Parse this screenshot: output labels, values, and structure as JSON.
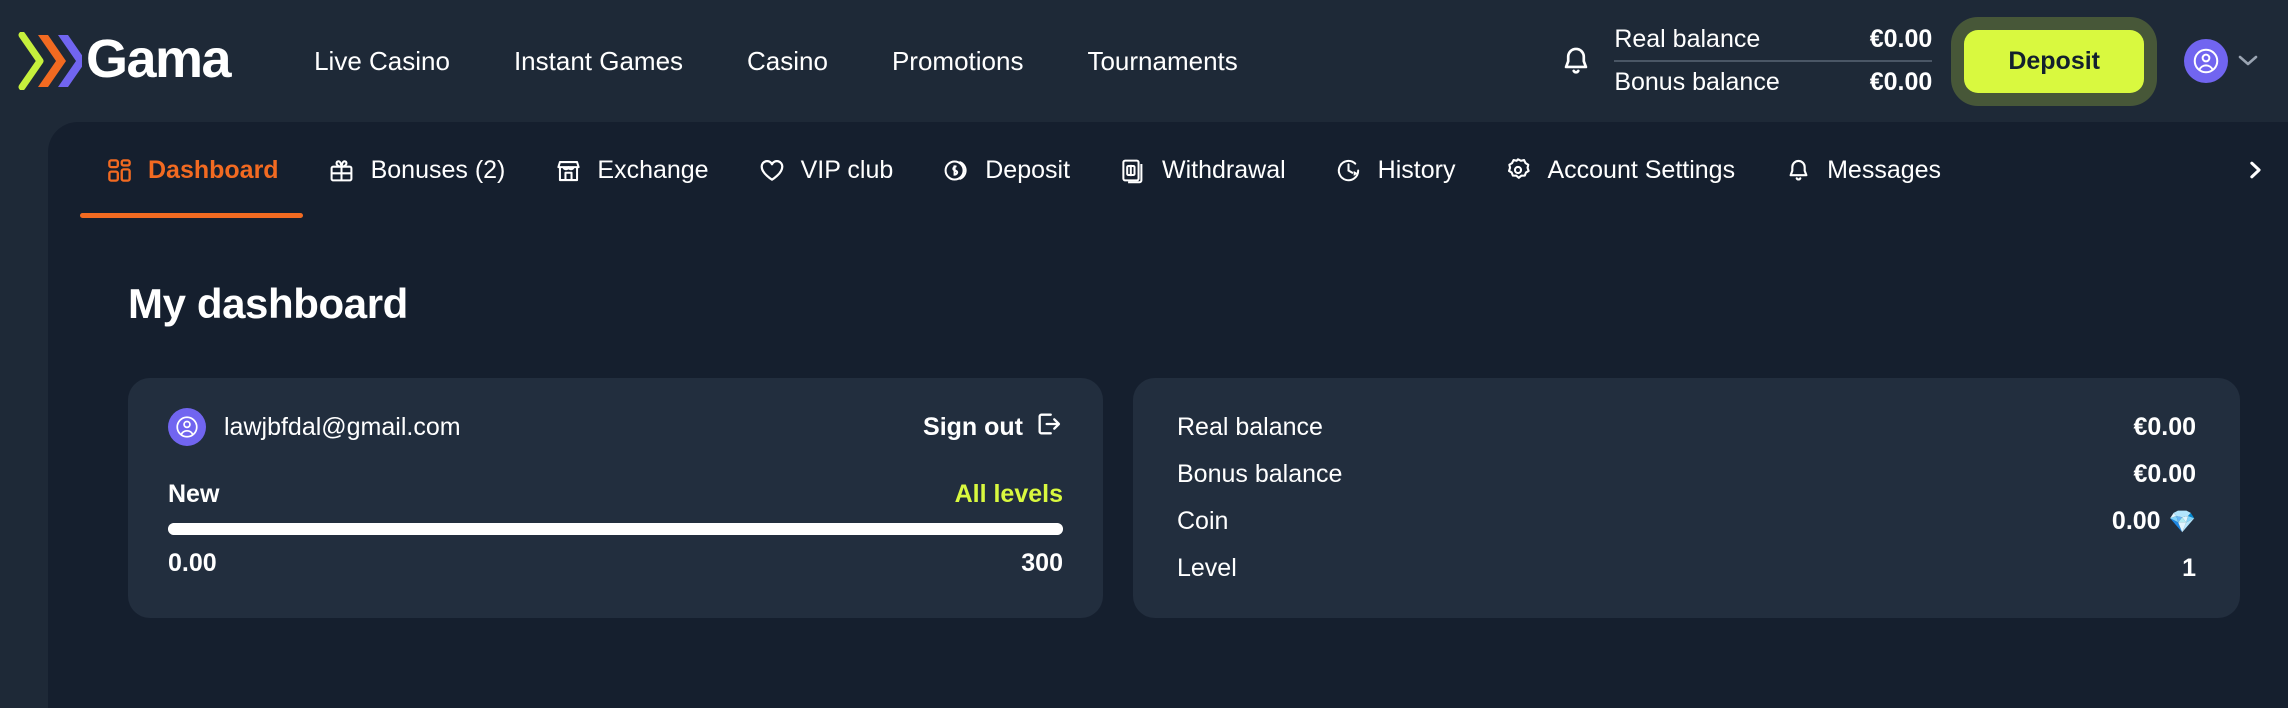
{
  "brand": {
    "name": "Gama",
    "chevron_colors": [
      "#c6f03c",
      "#f26a21",
      "#7165f0"
    ]
  },
  "header": {
    "nav": [
      {
        "label": "Live Casino"
      },
      {
        "label": "Instant Games"
      },
      {
        "label": "Casino"
      },
      {
        "label": "Promotions"
      },
      {
        "label": "Tournaments"
      }
    ],
    "bell_icon": "bell-icon",
    "balances": [
      {
        "label": "Real balance",
        "value": "€0.00"
      },
      {
        "label": "Bonus balance",
        "value": "€0.00"
      }
    ],
    "deposit_label": "Deposit",
    "deposit_color": "#d9f93f",
    "avatar_icon": "user-avatar-icon",
    "avatar_color": "#7165f0",
    "chevron_down": "⌄"
  },
  "tabs": [
    {
      "label": "Dashboard",
      "icon": "grid-icon",
      "active": true
    },
    {
      "label": "Bonuses (2)",
      "icon": "gift-icon",
      "active": false
    },
    {
      "label": "Exchange",
      "icon": "store-icon",
      "active": false
    },
    {
      "label": "VIP club",
      "icon": "heart-icon",
      "active": false
    },
    {
      "label": "Deposit",
      "icon": "coin-icon",
      "active": false
    },
    {
      "label": "Withdrawal",
      "icon": "banknote-icon",
      "active": false
    },
    {
      "label": "History",
      "icon": "clock-icon",
      "active": false
    },
    {
      "label": "Account Settings",
      "icon": "gear-icon",
      "active": false
    },
    {
      "label": "Messages",
      "icon": "bell-icon",
      "active": false
    }
  ],
  "tabs_next_icon": "chevron-right-icon",
  "active_tab_color": "#f26a21",
  "main": {
    "title": "My dashboard",
    "profile": {
      "email": "lawjbfdal@gmail.com",
      "avatar_icon": "user-avatar-icon",
      "signout_label": "Sign out",
      "signout_icon": "logout-icon",
      "level_name": "New",
      "all_levels_label": "All levels",
      "all_levels_color": "#d9f93f",
      "progress_value": "0.00",
      "progress_max": "300",
      "progress_percent": 0
    },
    "stats": [
      {
        "label": "Real balance",
        "value": "€0.00",
        "gem": ""
      },
      {
        "label": "Bonus balance",
        "value": "€0.00",
        "gem": ""
      },
      {
        "label": "Coin",
        "value": "0.00",
        "gem": "💎"
      },
      {
        "label": "Level",
        "value": "1",
        "gem": ""
      }
    ]
  }
}
